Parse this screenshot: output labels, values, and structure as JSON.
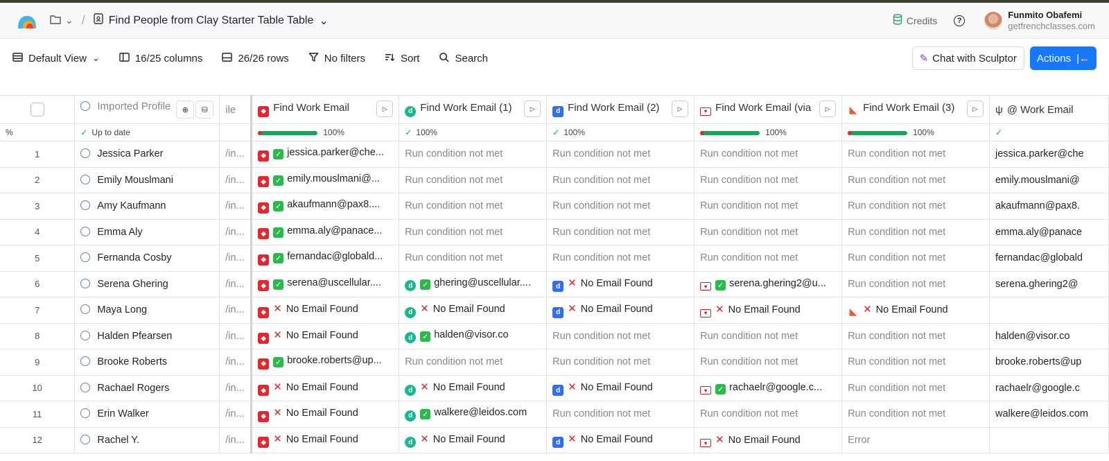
{
  "header": {
    "title": "Find People from Clay Starter Table Table",
    "credits": "Credits",
    "user_name": "Funmito Obafemi",
    "user_domain": "getfrenchclasses.com"
  },
  "toolbar": {
    "view": "Default View",
    "columns": "16/25 columns",
    "rows": "26/26 rows",
    "filters": "No filters",
    "sort": "Sort",
    "search": "Search",
    "sculptor": "Chat with Sculptor",
    "actions": "Actions"
  },
  "columns": {
    "imported": "Imported Profile",
    "partial": "ile",
    "c1": "Find Work Email",
    "c2": "Find Work Email (1)",
    "c3": "Find Work Email (2)",
    "c4": "Find Work Email (via",
    "c5": "Find Work Email (3)",
    "c6": "@ Work Email"
  },
  "status": {
    "rowlabel": "%",
    "imported": "Up to date",
    "pct": "100%"
  },
  "colors": {
    "accent": "#1677ff",
    "success": "#18a65a",
    "error": "#e0242a"
  },
  "rows": [
    {
      "n": "1",
      "name": "Jessica Parker",
      "li": "/in...",
      "c1": "jessica.parker@che...",
      "c1s": "ok",
      "c2": "Run condition not met",
      "c2s": "none",
      "c3": "Run condition not met",
      "c3s": "none",
      "c4": "Run condition not met",
      "c4s": "none",
      "c5": "Run condition not met",
      "c5s": "none",
      "c6": "jessica.parker@che"
    },
    {
      "n": "2",
      "name": "Emily Mouslmani",
      "li": "/in...",
      "c1": "emily.mouslmani@...",
      "c1s": "ok",
      "c2": "Run condition not met",
      "c2s": "none",
      "c3": "Run condition not met",
      "c3s": "none",
      "c4": "Run condition not met",
      "c4s": "none",
      "c5": "Run condition not met",
      "c5s": "none",
      "c6": "emily.mouslmani@"
    },
    {
      "n": "3",
      "name": "Amy Kaufmann",
      "li": "/in...",
      "c1": "akaufmann@pax8....",
      "c1s": "ok",
      "c2": "Run condition not met",
      "c2s": "none",
      "c3": "Run condition not met",
      "c3s": "none",
      "c4": "Run condition not met",
      "c4s": "none",
      "c5": "Run condition not met",
      "c5s": "none",
      "c6": "akaufmann@pax8."
    },
    {
      "n": "4",
      "name": "Emma Aly",
      "li": "/in...",
      "c1": "emma.aly@panace...",
      "c1s": "ok",
      "c2": "Run condition not met",
      "c2s": "none",
      "c3": "Run condition not met",
      "c3s": "none",
      "c4": "Run condition not met",
      "c4s": "none",
      "c5": "Run condition not met",
      "c5s": "none",
      "c6": "emma.aly@panace"
    },
    {
      "n": "5",
      "name": "Fernanda Cosby",
      "li": "/in...",
      "c1": "fernandac@globald...",
      "c1s": "ok",
      "c2": "Run condition not met",
      "c2s": "none",
      "c3": "Run condition not met",
      "c3s": "none",
      "c4": "Run condition not met",
      "c4s": "none",
      "c5": "Run condition not met",
      "c5s": "none",
      "c6": "fernandac@globald"
    },
    {
      "n": "6",
      "name": "Serena Ghering",
      "li": "/in...",
      "c1": "serena@uscellular....",
      "c1s": "ok",
      "c2": "ghering@uscellular....",
      "c2s": "ok",
      "c3": "No Email Found",
      "c3s": "x",
      "c4": "serena.ghering2@u...",
      "c4s": "ok",
      "c5": "Run condition not met",
      "c5s": "none",
      "c6": "serena.ghering2@"
    },
    {
      "n": "7",
      "name": "Maya Long",
      "li": "/in...",
      "c1": "No Email Found",
      "c1s": "x",
      "c2": "No Email Found",
      "c2s": "x",
      "c3": "No Email Found",
      "c3s": "x",
      "c4": "No Email Found",
      "c4s": "x",
      "c5": "No Email Found",
      "c5s": "x",
      "c6": ""
    },
    {
      "n": "8",
      "name": "Halden Pfearsen",
      "li": "/in...",
      "c1": "No Email Found",
      "c1s": "x",
      "c2": "halden@visor.co",
      "c2s": "ok",
      "c3": "Run condition not met",
      "c3s": "none",
      "c4": "Run condition not met",
      "c4s": "none",
      "c5": "Run condition not met",
      "c5s": "none",
      "c6": "halden@visor.co"
    },
    {
      "n": "9",
      "name": "Brooke Roberts",
      "li": "/in...",
      "c1": "brooke.roberts@up...",
      "c1s": "ok",
      "c2": "Run condition not met",
      "c2s": "none",
      "c3": "Run condition not met",
      "c3s": "none",
      "c4": "Run condition not met",
      "c4s": "none",
      "c5": "Run condition not met",
      "c5s": "none",
      "c6": "brooke.roberts@up"
    },
    {
      "n": "10",
      "name": "Rachael Rogers",
      "li": "/in...",
      "c1": "No Email Found",
      "c1s": "x",
      "c2": "No Email Found",
      "c2s": "x",
      "c3": "No Email Found",
      "c3s": "x",
      "c4": "rachaelr@google.c...",
      "c4s": "ok",
      "c5": "Run condition not met",
      "c5s": "none",
      "c6": "rachaelr@google.c"
    },
    {
      "n": "11",
      "name": "Erin Walker",
      "li": "/in...",
      "c1": "No Email Found",
      "c1s": "x",
      "c2": "walkere@leidos.com",
      "c2s": "ok",
      "c3": "Run condition not met",
      "c3s": "none",
      "c4": "Run condition not met",
      "c4s": "none",
      "c5": "Run condition not met",
      "c5s": "none",
      "c6": "walkere@leidos.com"
    },
    {
      "n": "12",
      "name": "Rachel Y.",
      "li": "/in...",
      "c1": "No Email Found",
      "c1s": "x",
      "c2": "No Email Found",
      "c2s": "x",
      "c3": "No Email Found",
      "c3s": "x",
      "c4": "No Email Found",
      "c4s": "x",
      "c5": "Error",
      "c5s": "none",
      "c6": ""
    }
  ]
}
